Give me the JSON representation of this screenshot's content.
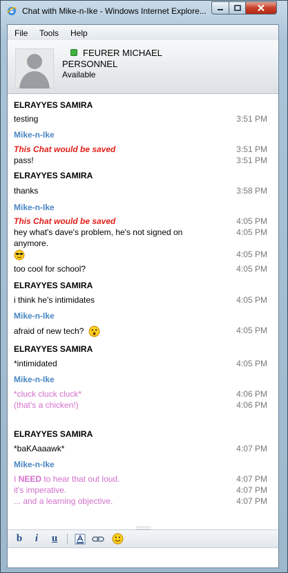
{
  "window": {
    "title": "Chat with Mike-n-Ike - Windows Internet Explore...",
    "buttons": {
      "minimize": "minimize",
      "maximize": "maximize",
      "close": "close"
    }
  },
  "menu": {
    "items": [
      "File",
      "Tools",
      "Help"
    ]
  },
  "contact": {
    "name": "FEURER MICHAEL",
    "line2": "PERSONNEL",
    "status": "Available",
    "status_color": "#3fb33f"
  },
  "colors": {
    "self_sender": "#000000",
    "other_sender": "#4a86c5",
    "notice": "#e0201a",
    "pink_text": "#d36fcc",
    "timestamp": "#777777"
  },
  "transcript": [
    {
      "sender": "ELRAYYES SAMIRA",
      "who": "self",
      "lines": [
        {
          "text": "testing",
          "time": "3:51 PM"
        }
      ]
    },
    {
      "sender": "Mike-n-Ike",
      "who": "other",
      "lines": [
        {
          "text": "This Chat would be saved",
          "time": "3:51 PM",
          "style": "notice"
        },
        {
          "text": "pass!",
          "time": "3:51 PM"
        }
      ]
    },
    {
      "sender": "ELRAYYES SAMIRA",
      "who": "self",
      "lines": [
        {
          "text": "thanks",
          "time": "3:58 PM"
        }
      ]
    },
    {
      "sender": "Mike-n-Ike",
      "who": "other",
      "lines": [
        {
          "text": "This Chat would be saved",
          "time": "4:05 PM",
          "style": "notice"
        },
        {
          "text": "hey what's dave's problem, he's not signed on",
          "time": "4:05 PM"
        },
        {
          "text": "anymore.",
          "time": ""
        },
        {
          "text": "",
          "time": "4:05 PM",
          "emoji": "cool-emoticon"
        },
        {
          "text": "too cool for school?",
          "time": "4:05 PM"
        }
      ]
    },
    {
      "sender": "ELRAYYES SAMIRA",
      "who": "self",
      "lines": [
        {
          "text": "i think he's intimidates",
          "time": "4:05 PM"
        }
      ]
    },
    {
      "sender": "Mike-n-Ike",
      "who": "other",
      "lines": [
        {
          "text": "afraid of new tech?",
          "time": "4:05 PM",
          "emoji": "surprised-emoticon"
        }
      ]
    },
    {
      "sender": "ELRAYYES SAMIRA",
      "who": "self",
      "lines": [
        {
          "text": "*intimidated",
          "time": "4:05 PM"
        }
      ]
    },
    {
      "sender": "Mike-n-Ike",
      "who": "other",
      "lines": [
        {
          "text": "*cluck cluck cluck*",
          "time": "4:06 PM",
          "style": "pink"
        },
        {
          "text": "(that's a chicken!)",
          "time": "4:06 PM",
          "style": "pink"
        }
      ]
    },
    {
      "sender": "ELRAYYES SAMIRA",
      "who": "self",
      "lines": [
        {
          "text": "*baKAaaawk*",
          "time": "4:07 PM"
        }
      ]
    },
    {
      "sender": "Mike-n-Ike",
      "who": "other",
      "lines": [
        {
          "text_parts": [
            "I ",
            "NEED",
            " to hear that out loud."
          ],
          "time": "4:07 PM",
          "style": "pink"
        },
        {
          "text": "it's imperative.",
          "time": "4:07 PM",
          "style": "pink"
        },
        {
          "text": "... and a learning objective.",
          "time": "4:07 PM",
          "style": "pink"
        }
      ]
    }
  ],
  "toolbar": {
    "bold": "b",
    "italic": "i",
    "underline": "u",
    "font_icon": "font-color-icon",
    "link_icon": "link-icon",
    "emoticon_icon": "emoticon-icon"
  }
}
